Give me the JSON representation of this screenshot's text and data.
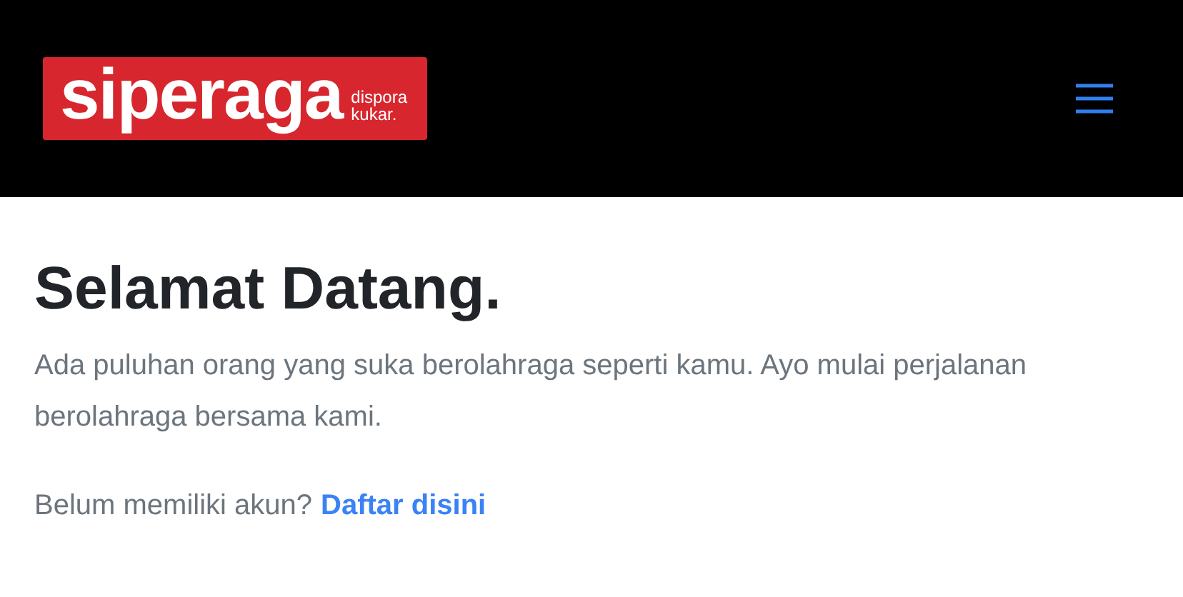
{
  "header": {
    "logo": {
      "name": "siperaga",
      "sub_lines": [
        "dispora",
        "kukar."
      ]
    }
  },
  "main": {
    "title": "Selamat Datang.",
    "intro": "Ada puluhan orang yang suka berolahraga seperti kamu. Ayo mulai perjalanan berolahraga bersama kami.",
    "signup_prompt": "Belum memiliki akun?",
    "signup_link": "Daftar disini"
  }
}
